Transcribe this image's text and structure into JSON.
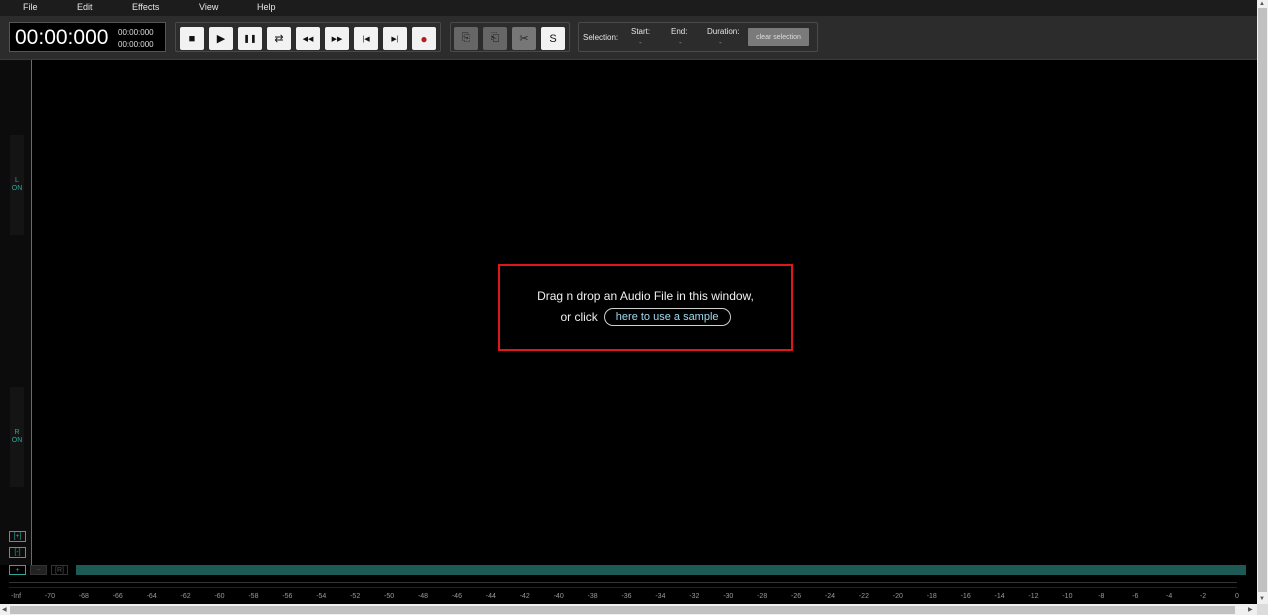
{
  "menu": [
    "File",
    "Edit",
    "Effects",
    "View",
    "Help"
  ],
  "time": {
    "main": "00:00:000",
    "sub1": "00:00:000",
    "sub2": "00:00:000"
  },
  "transport": {
    "stop": "■",
    "play": "▶",
    "pause": "❚❚",
    "loop": "⇄",
    "rewind": "◀◀",
    "forward": "▶▶",
    "skip_start": "|◀",
    "skip_end": "▶|",
    "record": "●"
  },
  "edit_tools": {
    "copy": "⎘",
    "paste": "⎗",
    "cut": "✂",
    "solo": "S"
  },
  "selection": {
    "label": "Selection:",
    "start_label": "Start:",
    "end_label": "End:",
    "duration_label": "Duration:",
    "start_value": "-",
    "end_value": "-",
    "duration_value": "-",
    "clear": "clear selection"
  },
  "channels": [
    {
      "letter": "L",
      "state": "ON"
    },
    {
      "letter": "R",
      "state": "ON"
    }
  ],
  "zoom": {
    "in": "[+]",
    "out": "[-]"
  },
  "bottom": {
    "plus": "+",
    "minus": "−",
    "reset": "[R]"
  },
  "dropzone": {
    "line1": "Drag n drop an Audio File in this window,",
    "line2": "or click",
    "sample_button": "here to use a sample"
  },
  "ruler": [
    "-Inf",
    "-70",
    "-68",
    "-66",
    "-64",
    "-62",
    "-60",
    "-58",
    "-56",
    "-54",
    "-52",
    "-50",
    "-48",
    "-46",
    "-44",
    "-42",
    "-40",
    "-38",
    "-36",
    "-34",
    "-32",
    "-30",
    "-28",
    "-26",
    "-24",
    "-22",
    "-20",
    "-18",
    "-16",
    "-14",
    "-12",
    "-10",
    "-8",
    "-6",
    "-4",
    "-2",
    "0"
  ],
  "colors": {
    "accent": "#2fa89a",
    "dropzone_border": "#e0161a",
    "cursor": "#b2532c",
    "record": "#b71c1c"
  }
}
